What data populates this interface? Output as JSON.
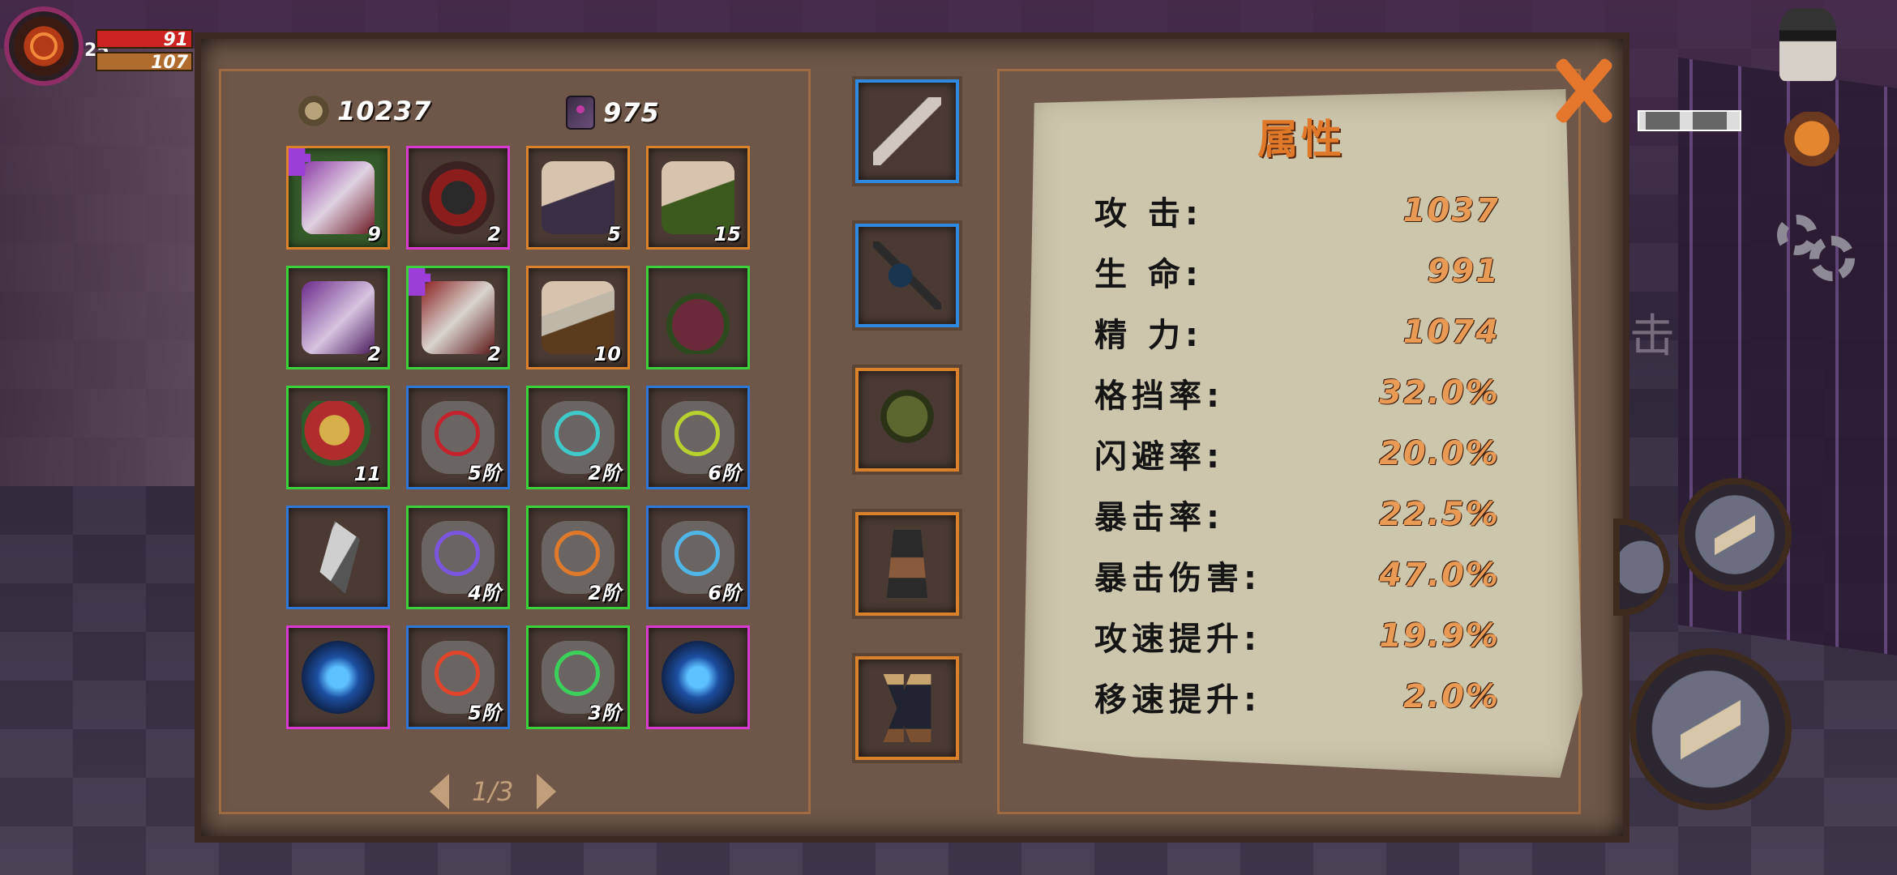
{
  "hud": {
    "level": "25",
    "hp": "91",
    "mp": "107"
  },
  "currency": {
    "coins": "10237",
    "gems": "975"
  },
  "inventory": [
    {
      "qty": "9"
    },
    {
      "qty": "2"
    },
    {
      "qty": "5"
    },
    {
      "qty": "15"
    },
    {
      "qty": "2"
    },
    {
      "qty": "2"
    },
    {
      "qty": "10"
    },
    {
      "qty": ""
    },
    {
      "qty": "11"
    },
    {
      "qty": "5阶"
    },
    {
      "qty": "2阶"
    },
    {
      "qty": "6阶"
    },
    {
      "qty": ""
    },
    {
      "qty": "4阶"
    },
    {
      "qty": "2阶"
    },
    {
      "qty": "6阶"
    },
    {
      "qty": ""
    },
    {
      "qty": "5阶"
    },
    {
      "qty": "3阶"
    },
    {
      "qty": ""
    }
  ],
  "pager": {
    "text": "1/3"
  },
  "attributes": {
    "title": "属性",
    "rows": [
      {
        "label": "攻 击:",
        "value": "1037"
      },
      {
        "label": "生 命:",
        "value": "991"
      },
      {
        "label": "精 力:",
        "value": "1074"
      },
      {
        "label": "格挡率:",
        "value": "32.0%"
      },
      {
        "label": "闪避率:",
        "value": "20.0%"
      },
      {
        "label": "暴击率:",
        "value": "22.5%"
      },
      {
        "label": "暴击伤害:",
        "value": "47.0%"
      },
      {
        "label": "攻速提升:",
        "value": "19.9%"
      },
      {
        "label": "移速提升:",
        "value": "2.0%"
      }
    ]
  },
  "background": {
    "ghost_text": "击"
  },
  "colors": {
    "accent": "#e07a2a",
    "rarity_orange": "#d9822b",
    "rarity_magenta": "#d63ad0",
    "rarity_green": "#3ad13a",
    "rarity_blue": "#2d78d6"
  }
}
